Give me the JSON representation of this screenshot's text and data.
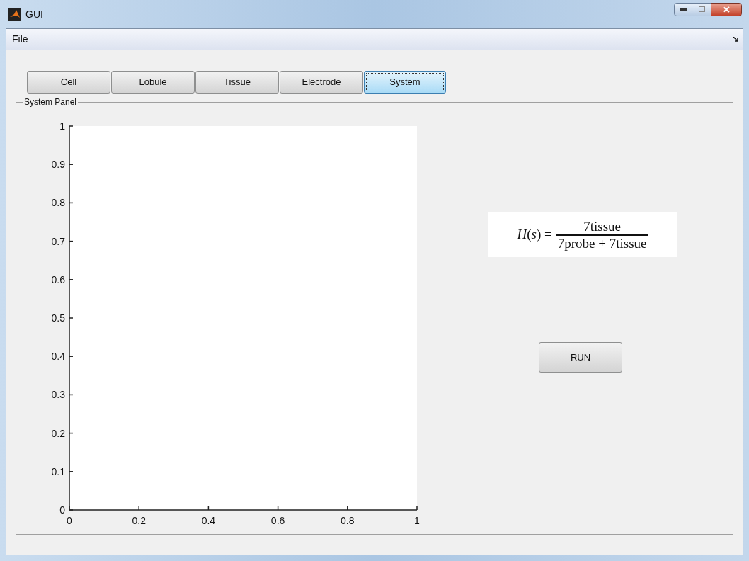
{
  "window": {
    "title": "GUI"
  },
  "menu": [
    {
      "label": "File"
    }
  ],
  "tabs": [
    {
      "label": "Cell",
      "selected": false
    },
    {
      "label": "Lobule",
      "selected": false
    },
    {
      "label": "Tissue",
      "selected": false
    },
    {
      "label": "Electrode",
      "selected": false
    },
    {
      "label": "System",
      "selected": true
    }
  ],
  "panel": {
    "title": "System Panel",
    "chart_data": {
      "type": "line",
      "xlim": [
        0,
        1
      ],
      "ylim": [
        0,
        1
      ],
      "xticks": [
        0,
        0.2,
        0.4,
        0.6,
        0.8,
        1
      ],
      "yticks": [
        0,
        0.1,
        0.2,
        0.3,
        0.4,
        0.5,
        0.6,
        0.7,
        0.8,
        0.9,
        1
      ]
    },
    "formula": {
      "lhs": "*H*(*s*) =",
      "numerator": "7tissue",
      "denominator": "7probe + 7tissue"
    },
    "run_button": "RUN"
  }
}
